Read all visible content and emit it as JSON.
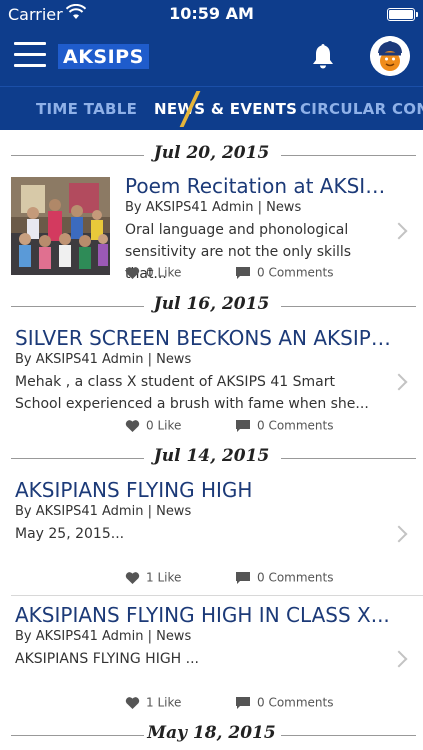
{
  "status": {
    "carrier": "Carrier",
    "time": "10:59 AM"
  },
  "header": {
    "brand": "AKSIPS"
  },
  "tabs": [
    {
      "label": "TIME TABLE"
    },
    {
      "label": "NEWS & EVENTS"
    },
    {
      "label": "CIRCULAR"
    },
    {
      "label": "CON"
    }
  ],
  "feed": {
    "dates": [
      "Jul 20, 2015",
      "Jul 16, 2015",
      "Jul 14, 2015",
      "May 18, 2015"
    ],
    "posts": [
      {
        "title": "Poem Recitation at  AKSIPS...",
        "byline": "By AKSIPS41 Admin | News",
        "excerpt_1": "Oral language and phonological",
        "excerpt_2": "sensitivity are not the only skills that...",
        "likes": "0 Like",
        "comments": "0 Comments"
      },
      {
        "title": "SILVER SCREEN BECKONS  AN AKSIPS...",
        "byline": "By AKSIPS41 Admin | News",
        "excerpt_1": "Mehak , a class X  student of AKSIPS 41 Smart",
        "excerpt_2": "School experienced a brush with fame when she...",
        "likes": "0 Like",
        "comments": "0 Comments"
      },
      {
        "title": "AKSIPIANS FLYING HIGH",
        "byline": "By AKSIPS41 Admin | News",
        "excerpt_1": "May 25, 2015...",
        "likes": "1 Like",
        "comments": "0 Comments"
      },
      {
        "title": "AKSIPIANS FLYING HIGH IN CLASS X...",
        "byline": "By AKSIPS41 Admin | News",
        "excerpt_1": "AKSIPIANS FLYING HIGH ...",
        "likes": "1 Like",
        "comments": "0 Comments"
      }
    ]
  },
  "colors": {
    "header_bg": "#0e3d8c",
    "brand_bg": "#1f5ccc",
    "title": "#1c3a78",
    "tab_inactive": "#8fb1e8",
    "tab_accent": "#e5b53a"
  },
  "icons": [
    "wifi-icon",
    "battery-icon",
    "menu-icon",
    "bell-icon",
    "avatar-icon",
    "heart-icon",
    "comment-icon",
    "chevron-right-icon"
  ]
}
